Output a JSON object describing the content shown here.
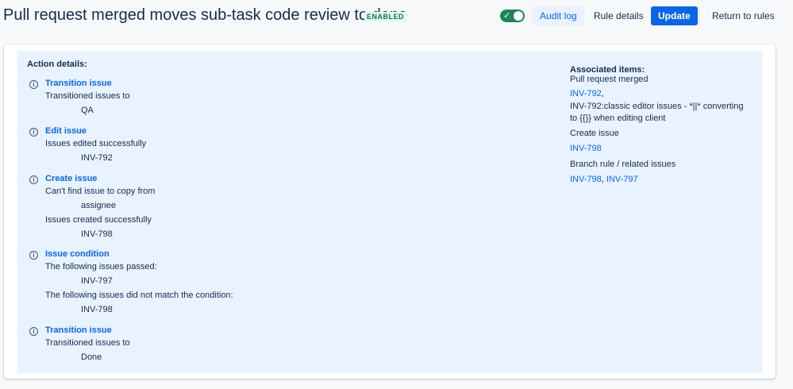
{
  "header": {
    "title": "Pull request merged moves sub-task code review to done",
    "status_badge": "ENABLED",
    "toggle_check": "✓",
    "buttons": {
      "audit_log": "Audit log",
      "rule_details": "Rule details",
      "update": "Update",
      "return_to_rules": "Return to rules"
    }
  },
  "colors": {
    "primary": "#0c66e4",
    "toggle_on": "#1f845a",
    "panel_bg": "#e9f2ff",
    "badge_text": "#216e4e"
  },
  "left": {
    "heading": "Action details:",
    "info_icon": "i",
    "actions": [
      {
        "title": "Transition issue",
        "lines": [
          "Transitioned issues to",
          "QA"
        ]
      },
      {
        "title": "Edit issue",
        "lines": [
          "Issues edited successfully",
          "INV-792"
        ]
      },
      {
        "title": "Create issue",
        "lines": [
          "Can't find issue to copy from",
          "assignee",
          "Issues created successfully",
          "INV-798"
        ]
      },
      {
        "title": "Issue condition",
        "lines": [
          "The following issues passed:",
          "INV-797",
          "The following issues did not match the condition:",
          "INV-798"
        ]
      },
      {
        "title": "Transition issue",
        "lines": [
          "Transitioned issues to",
          "Done"
        ]
      }
    ]
  },
  "right": {
    "heading": "Associated items:",
    "group1_label": "Pull request merged",
    "group1_link": "INV-792",
    "group1_comma": ",",
    "group1_desc_line1": "INV-792:classic editor issues - *||* converting",
    "group1_desc_line2": "to {{}} when editing client",
    "group2_label": "Create issue",
    "group2_link": "INV-798",
    "group3_label": "Branch rule / related issues",
    "group3_link1": "INV-798",
    "group3_sep": ",",
    "group3_link2": "INV-797"
  }
}
